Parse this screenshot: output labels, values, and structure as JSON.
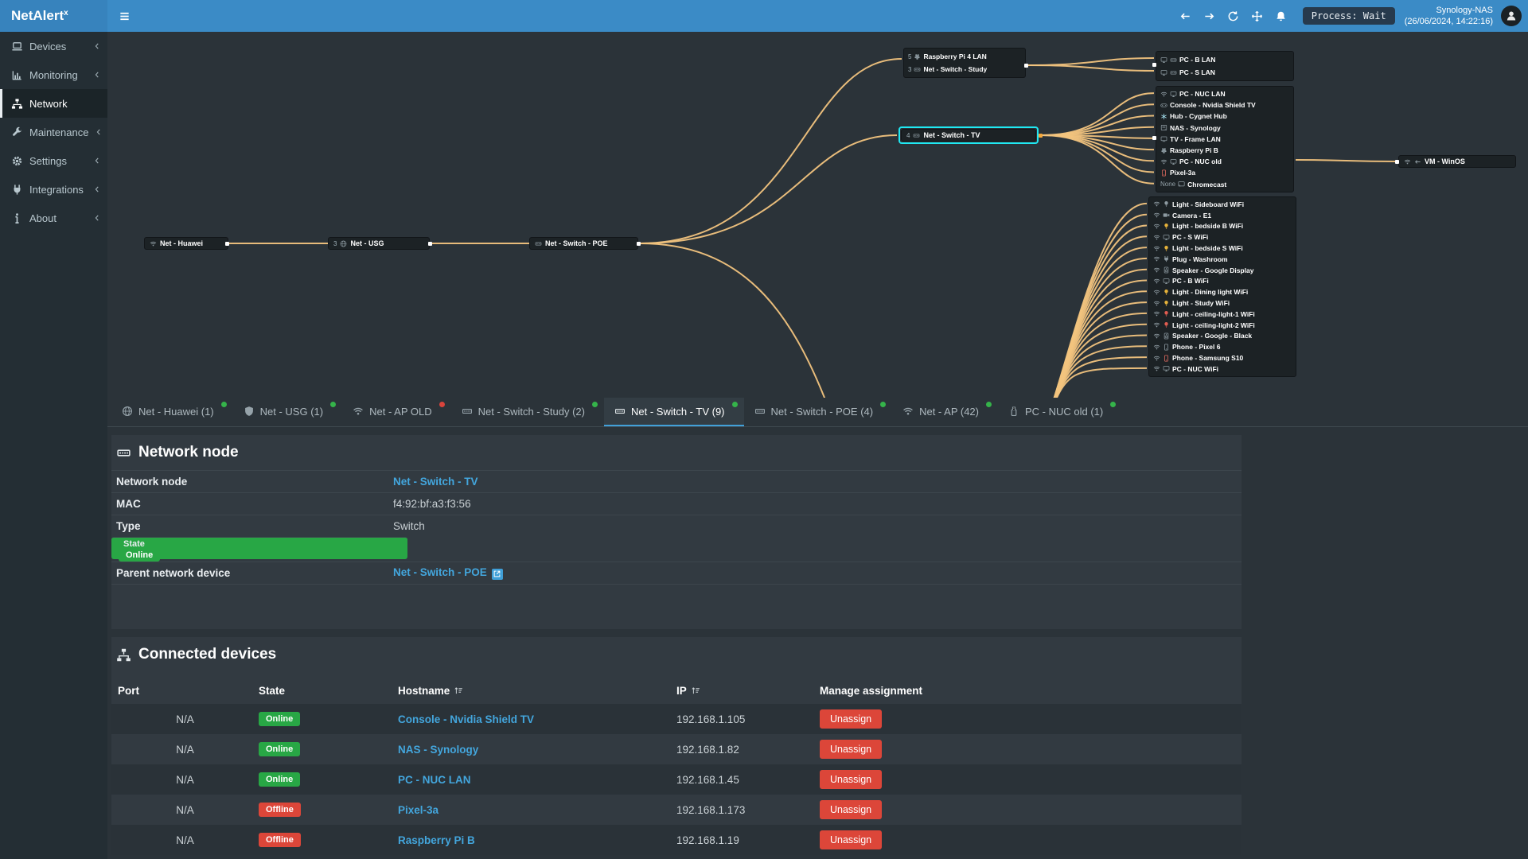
{
  "colors": {
    "topbar": "#3b8bc6",
    "selection": "#1fe8f2",
    "connection_line": "#f2c47e",
    "online": "#28a745",
    "offline": "#dc4639",
    "link": "#43a6dd"
  },
  "header": {
    "brand": "NetAlert",
    "brand_sup": "x",
    "menu_icon": "bars",
    "bell_icon": "bell",
    "avatar_icon": "user",
    "nav_icons": [
      {
        "name": "nav-back-button",
        "icon": "arrow-left"
      },
      {
        "name": "nav-forward-button",
        "icon": "arrow-right"
      },
      {
        "name": "refresh-button",
        "icon": "refresh"
      },
      {
        "name": "pan-move-button",
        "icon": "move"
      }
    ],
    "process_badge": "Process: Wait",
    "host_name": "Synology-NAS",
    "host_time": "(26/06/2024, 14:22:16)"
  },
  "sidebar": {
    "items": [
      {
        "name": "sidebar-item-devices",
        "label": "Devices",
        "icon": "laptop",
        "chevron": "angle-left",
        "state": ""
      },
      {
        "name": "sidebar-item-monitoring",
        "label": "Monitoring",
        "icon": "chart",
        "chevron": "angle-left",
        "state": ""
      },
      {
        "name": "sidebar-item-network",
        "label": "Network",
        "icon": "sitemap",
        "chevron": "",
        "state": "active"
      },
      {
        "name": "sidebar-item-maintenance",
        "label": "Maintenance",
        "icon": "wrench",
        "chevron": "angle-left",
        "state": ""
      },
      {
        "name": "sidebar-item-settings",
        "label": "Settings",
        "icon": "gear",
        "chevron": "angle-left",
        "state": ""
      },
      {
        "name": "sidebar-item-integrations",
        "label": "Integrations",
        "icon": "plug",
        "chevron": "angle-left",
        "state": ""
      },
      {
        "name": "sidebar-item-about",
        "label": "About",
        "icon": "info",
        "chevron": "angle-left",
        "state": ""
      }
    ]
  },
  "topology": {
    "backbone": [
      {
        "label": "Net - Huawei",
        "port": "",
        "icons": [
          {
            "n": "wifi"
          }
        ]
      },
      {
        "label": "Net - USG",
        "port": "3",
        "icons": [
          {
            "n": "globe"
          }
        ]
      },
      {
        "label": "Net - Switch - POE",
        "port": "",
        "icons": [
          {
            "n": "eth"
          }
        ]
      }
    ],
    "study_group": [
      {
        "label": "Raspberry Pi 4 LAN",
        "port": "5",
        "icons": [
          {
            "n": "pi"
          }
        ]
      },
      {
        "label": "Net - Switch - Study",
        "port": "3",
        "icons": [
          {
            "n": "eth"
          }
        ]
      }
    ],
    "selected_node": {
      "label": "Net - Switch - TV",
      "port": "4",
      "icons": [
        {
          "n": "eth"
        }
      ]
    },
    "lan_group": [
      {
        "label": "PC - B LAN",
        "icons": [
          {
            "n": "monitor"
          },
          {
            "n": "eth"
          }
        ]
      },
      {
        "label": "PC - S LAN",
        "icons": [
          {
            "n": "monitor"
          },
          {
            "n": "eth"
          }
        ]
      }
    ],
    "tv_group": [
      {
        "label": "PC - NUC LAN",
        "icons": [
          {
            "n": "wifi"
          },
          {
            "n": "monitor"
          }
        ]
      },
      {
        "label": "Console - Nvidia Shield TV",
        "icons": [
          {
            "n": "console"
          }
        ]
      },
      {
        "label": "Hub - Cygnet Hub",
        "icons": [
          {
            "n": "hub",
            "c": "#9fd9e8"
          }
        ]
      },
      {
        "label": "NAS - Synology",
        "icons": [
          {
            "n": "nas"
          }
        ]
      },
      {
        "label": "TV - Frame LAN",
        "icons": [
          {
            "n": "tv"
          }
        ]
      },
      {
        "label": "Raspberry Pi B",
        "icons": [
          {
            "n": "pi"
          }
        ]
      },
      {
        "label": "PC - NUC old",
        "icons": [
          {
            "n": "wifi"
          },
          {
            "n": "monitor"
          }
        ]
      },
      {
        "label": "Pixel-3a",
        "icons": [
          {
            "n": "phone",
            "c": "#e06a5f"
          }
        ]
      },
      {
        "label": "Chromecast",
        "prefix": "None",
        "icons": [
          {
            "n": "cast"
          }
        ]
      }
    ],
    "vm_node": {
      "label": "VM - WinOS",
      "icons": [
        {
          "n": "wifi"
        },
        {
          "n": "arrow-left"
        }
      ]
    },
    "wifi_group": [
      {
        "label": "Light - Sideboard WiFi",
        "icons": [
          {
            "n": "wifi"
          },
          {
            "n": "bulb"
          }
        ]
      },
      {
        "label": "Camera - E1",
        "icons": [
          {
            "n": "wifi"
          },
          {
            "n": "camera"
          }
        ]
      },
      {
        "label": "Light - bedside B WiFi",
        "icons": [
          {
            "n": "wifi"
          },
          {
            "n": "bulb",
            "c": "#e6b23a"
          }
        ]
      },
      {
        "label": "PC - S WiFi",
        "icons": [
          {
            "n": "wifi"
          },
          {
            "n": "monitor"
          }
        ]
      },
      {
        "label": "Light - bedside S WiFi",
        "icons": [
          {
            "n": "wifi"
          },
          {
            "n": "bulb",
            "c": "#e6b23a"
          }
        ]
      },
      {
        "label": "Plug - Washroom",
        "icons": [
          {
            "n": "wifi"
          },
          {
            "n": "plug"
          }
        ]
      },
      {
        "label": "Speaker - Google Display",
        "icons": [
          {
            "n": "wifi"
          },
          {
            "n": "speaker"
          }
        ]
      },
      {
        "label": "PC - B WiFi",
        "icons": [
          {
            "n": "wifi"
          },
          {
            "n": "monitor"
          }
        ]
      },
      {
        "label": "Light - Dining light WiFi",
        "icons": [
          {
            "n": "wifi"
          },
          {
            "n": "bulb",
            "c": "#e6b23a"
          }
        ]
      },
      {
        "label": "Light - Study WiFi",
        "icons": [
          {
            "n": "wifi"
          },
          {
            "n": "bulb",
            "c": "#e6b23a"
          }
        ]
      },
      {
        "label": "Light - ceiling-light-1 WiFi",
        "icons": [
          {
            "n": "wifi"
          },
          {
            "n": "bulb",
            "c": "#e05c50"
          }
        ]
      },
      {
        "label": "Light - ceiling-light-2 WiFi",
        "icons": [
          {
            "n": "wifi"
          },
          {
            "n": "bulb",
            "c": "#e05c50"
          }
        ]
      },
      {
        "label": "Speaker - Google - Black",
        "icons": [
          {
            "n": "wifi"
          },
          {
            "n": "speaker"
          }
        ]
      },
      {
        "label": "Phone - Pixel 6",
        "icons": [
          {
            "n": "wifi"
          },
          {
            "n": "phone"
          }
        ]
      },
      {
        "label": "Phone - Samsung S10",
        "icons": [
          {
            "n": "wifi"
          },
          {
            "n": "phone",
            "c": "#e06a5f"
          }
        ]
      },
      {
        "label": "PC - NUC WiFi",
        "icons": [
          {
            "n": "wifi"
          },
          {
            "n": "monitor"
          }
        ]
      }
    ]
  },
  "tabs": [
    {
      "name": "tab-net-huawei",
      "label": "Net - Huawei (1)",
      "icon": "globe",
      "dot": "green",
      "state": ""
    },
    {
      "name": "tab-net-usg",
      "label": "Net - USG (1)",
      "icon": "shield",
      "dot": "green",
      "state": ""
    },
    {
      "name": "tab-net-ap-old",
      "label": "Net - AP OLD",
      "icon": "wifi",
      "dot": "red",
      "state": ""
    },
    {
      "name": "tab-net-switch-study",
      "label": "Net - Switch - Study (2)",
      "icon": "eth",
      "dot": "green",
      "state": ""
    },
    {
      "name": "tab-net-switch-tv",
      "label": "Net - Switch - TV (9)",
      "icon": "eth",
      "dot": "green",
      "state": "active"
    },
    {
      "name": "tab-net-switch-poe",
      "label": "Net - Switch - POE (4)",
      "icon": "eth",
      "dot": "green",
      "state": ""
    },
    {
      "name": "tab-net-ap",
      "label": "Net - AP (42)",
      "icon": "wifi",
      "dot": "green",
      "state": ""
    },
    {
      "name": "tab-pc-nuc-old",
      "label": "PC - NUC old (1)",
      "icon": "usb",
      "dot": "green",
      "state": ""
    }
  ],
  "node_details": {
    "title": "Network node",
    "title_icon": "eth",
    "ext_icon": "ext-link",
    "rows": [
      {
        "label": "Network node",
        "value": "Net - Switch - TV",
        "type": "t-link",
        "clickable": "true"
      },
      {
        "label": "MAC",
        "value": "f4:92:bf:a3:f3:56",
        "type": "t-plain",
        "clickable": "false"
      },
      {
        "label": "Type",
        "value": "Switch",
        "type": "t-plain",
        "clickable": "false"
      },
      {
        "label": "State",
        "value": "Online",
        "type": "t-badge",
        "clickable": "false"
      },
      {
        "label": "Parent network device",
        "value": "Net - Switch - POE",
        "type": "t-link-ext",
        "clickable": "true"
      }
    ]
  },
  "connected": {
    "title": "Connected devices",
    "title_icon": "sitemap",
    "sort_icon": "sort",
    "columns": {
      "port": "Port",
      "state": "State",
      "hostname": "Hostname",
      "ip": "IP",
      "manage": "Manage assignment"
    },
    "rows": [
      {
        "port": "N/A",
        "state": "Online",
        "state_class": "online",
        "hostname": "Console - Nvidia Shield TV",
        "ip": "192.168.1.105",
        "action": "Unassign"
      },
      {
        "port": "N/A",
        "state": "Online",
        "state_class": "online",
        "hostname": "NAS - Synology",
        "ip": "192.168.1.82",
        "action": "Unassign"
      },
      {
        "port": "N/A",
        "state": "Online",
        "state_class": "online",
        "hostname": "PC - NUC LAN",
        "ip": "192.168.1.45",
        "action": "Unassign"
      },
      {
        "port": "N/A",
        "state": "Offline",
        "state_class": "offline",
        "hostname": "Pixel-3a",
        "ip": "192.168.1.173",
        "action": "Unassign"
      },
      {
        "port": "N/A",
        "state": "Offline",
        "state_class": "offline",
        "hostname": "Raspberry Pi B",
        "ip": "192.168.1.19",
        "action": "Unassign"
      }
    ]
  }
}
